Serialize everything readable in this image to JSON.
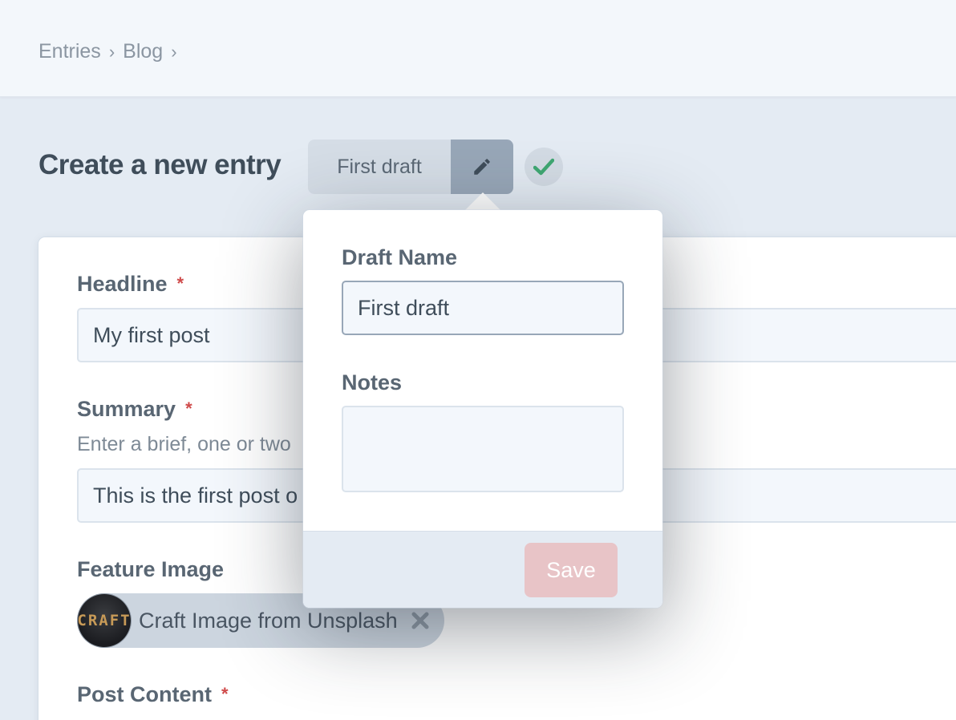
{
  "breadcrumb": {
    "items": [
      {
        "label": "Entries"
      },
      {
        "label": "Blog"
      }
    ],
    "separator": "›"
  },
  "header": {
    "title": "Create a new entry",
    "draft_name": "First draft"
  },
  "fields": {
    "headline": {
      "label": "Headline",
      "required_mark": "*",
      "value": "My first post"
    },
    "summary": {
      "label": "Summary",
      "required_mark": "*",
      "instructions": "Enter a brief, one or two",
      "value": "This is the first post o"
    },
    "feature_image": {
      "label": "Feature Image",
      "asset_title": "Craft Image from Unsplash",
      "thumb_text": "CRAFT"
    },
    "post_content": {
      "label": "Post Content",
      "required_mark": "*"
    }
  },
  "popover": {
    "draft_name_label": "Draft Name",
    "draft_name_value": "First draft",
    "notes_label": "Notes",
    "notes_value": "",
    "save_label": "Save"
  },
  "colors": {
    "background": "#e4ebf3",
    "required": "#cf4a4a",
    "check": "#3fa772",
    "save_disabled": "#e8c4c7"
  },
  "icons": {
    "edit": "pencil-icon",
    "confirm": "check-icon",
    "remove": "close-icon",
    "resize": "resize-grip-icon"
  }
}
